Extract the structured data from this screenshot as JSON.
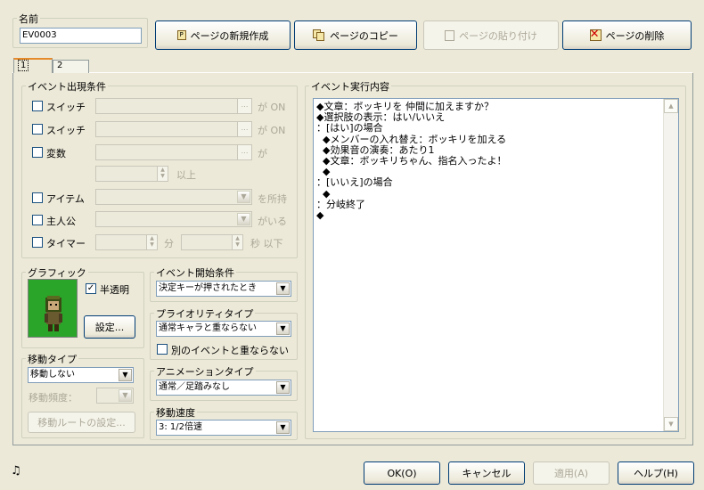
{
  "name_label": "名前",
  "name_value": "EV0003",
  "toolbar": {
    "new_page": "ページの新規作成",
    "copy_page": "ページのコピー",
    "paste_page": "ページの貼り付け",
    "delete_page": "ページの削除"
  },
  "tabs": [
    "1",
    "2"
  ],
  "conditions": {
    "legend": "イベント出現条件",
    "switch1": "スイッチ",
    "switch1_suffix": "が ON",
    "switch2": "スイッチ",
    "switch2_suffix": "が ON",
    "variable": "変数",
    "variable_suffix": "が",
    "above": "以上",
    "item": "アイテム",
    "item_suffix": "を所持",
    "actor": "主人公",
    "actor_suffix": "がいる",
    "timer": "タイマー",
    "minutes": "分",
    "seconds_below": "秒 以下"
  },
  "graphic": {
    "legend": "グラフィック",
    "translucent": "半透明",
    "settings_button": "設定..."
  },
  "trigger": {
    "legend": "イベント開始条件",
    "value": "決定キーが押されたとき"
  },
  "priority": {
    "legend": "プライオリティタイプ",
    "value": "通常キャラと重ならない",
    "no_overlap": "別のイベントと重ならない"
  },
  "animation": {
    "legend": "アニメーションタイプ",
    "value": "通常／足踏みなし"
  },
  "speed": {
    "legend": "移動速度",
    "value": "3: 1/2倍速"
  },
  "movement": {
    "legend": "移動タイプ",
    "value": "移動しない",
    "frequency_label": "移動頻度：",
    "route_button": "移動ルートの設定..."
  },
  "contents": {
    "legend": "イベント実行内容",
    "lines": [
      "◆文章：ボッキリを 仲間に加えますか？",
      "◆選択肢の表示：はい/いいえ",
      "：[はい]の場合",
      "  ◆メンバーの入れ替え：ボッキリを加える",
      "  ◆効果音の演奏：あたり1",
      "  ◆文章：ボッキリちゃん、指名入ったよ！",
      "  ◆",
      "：[いいえ]の場合",
      "  ◆",
      "：分岐終了",
      "◆"
    ]
  },
  "footer": {
    "ok": "OK(O)",
    "cancel": "キャンセル",
    "apply": "適用(A)",
    "help": "ヘルプ(H)"
  }
}
